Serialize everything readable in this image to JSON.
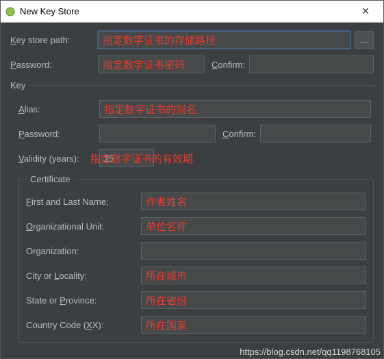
{
  "window": {
    "title": "New Key Store",
    "close": "✕"
  },
  "keyStorePath": {
    "prefix": "K",
    "rest": "ey store path:",
    "annotation": "指定数字证书的存储路径",
    "browse": "..."
  },
  "password": {
    "prefix": "P",
    "rest": "assword:",
    "annotation": "指定数字证书密码",
    "confirmPrefix": "C",
    "confirmRest": "onfirm:"
  },
  "keyGroup": {
    "legend": "Key"
  },
  "alias": {
    "prefix": "A",
    "rest": "lias:",
    "annotation": "指定数字证书的别名"
  },
  "keyPassword": {
    "prefix": "P",
    "rest": "assword:",
    "confirmPrefix": "C",
    "confirmRest": "onfirm:"
  },
  "validity": {
    "prefix": "V",
    "rest": "alidity (years):",
    "value": "25",
    "annotation": "指定数字证书的有效期"
  },
  "certificate": {
    "legend": "Certificate"
  },
  "firstLast": {
    "prefix": "F",
    "rest": "irst and Last Name:",
    "annotation": "作者姓名"
  },
  "orgUnit": {
    "prefix": "O",
    "rest": "rganizational Unit:",
    "annotation": "单位名称"
  },
  "org": {
    "label": "Organization:"
  },
  "city": {
    "before": "City or ",
    "prefix": "L",
    "rest": "ocality:",
    "annotation": "所在城市"
  },
  "state": {
    "before": "State or ",
    "prefix": "P",
    "rest": "rovince:",
    "annotation": "所在省份"
  },
  "country": {
    "before": "Country Code (",
    "prefix": "X",
    "rest": "X):",
    "annotation": "所在国家"
  },
  "watermark": "https://blog.csdn.net/qq1198768105"
}
